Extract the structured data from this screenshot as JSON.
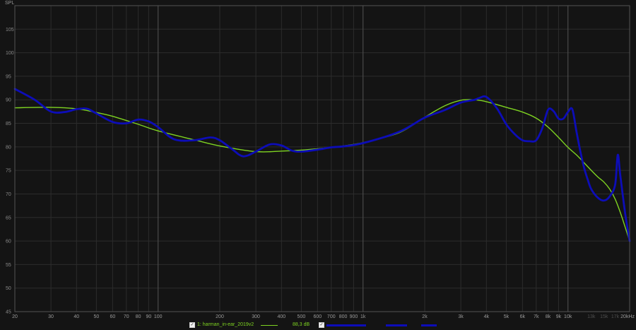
{
  "chart_data": {
    "type": "line",
    "ylabel": "SPL",
    "xscale": "log",
    "xlim": [
      20,
      20000
    ],
    "ylim": [
      45,
      110
    ],
    "grid": true,
    "yticks": [
      45,
      50,
      55,
      60,
      65,
      70,
      75,
      80,
      85,
      90,
      95,
      100,
      105
    ],
    "xticks": [
      {
        "v": 20,
        "t": "20"
      },
      {
        "v": 30,
        "t": "30"
      },
      {
        "v": 40,
        "t": "40"
      },
      {
        "v": 50,
        "t": "50"
      },
      {
        "v": 60,
        "t": "60"
      },
      {
        "v": 70,
        "t": "70"
      },
      {
        "v": 80,
        "t": "80"
      },
      {
        "v": 90,
        "t": "90"
      },
      {
        "v": 100,
        "t": "100"
      },
      {
        "v": 200,
        "t": "200"
      },
      {
        "v": 300,
        "t": "300"
      },
      {
        "v": 400,
        "t": "400"
      },
      {
        "v": 500,
        "t": "500"
      },
      {
        "v": 600,
        "t": "600"
      },
      {
        "v": 700,
        "t": "700"
      },
      {
        "v": 800,
        "t": "800"
      },
      {
        "v": 900,
        "t": "900"
      },
      {
        "v": 1000,
        "t": "1k"
      },
      {
        "v": 2000,
        "t": "2k"
      },
      {
        "v": 3000,
        "t": "3k"
      },
      {
        "v": 4000,
        "t": "4k"
      },
      {
        "v": 5000,
        "t": "5k"
      },
      {
        "v": 6000,
        "t": "6k"
      },
      {
        "v": 7000,
        "t": "7k"
      },
      {
        "v": 8000,
        "t": "8k"
      },
      {
        "v": 9000,
        "t": "9k"
      },
      {
        "v": 10000,
        "t": "10k"
      },
      {
        "v": 13000,
        "t": "13k"
      },
      {
        "v": 15000,
        "t": "15k"
      },
      {
        "v": 17000,
        "t": "17k"
      },
      {
        "v": 20000,
        "t": "20kHz"
      }
    ],
    "series": [
      {
        "name": "1: harman_in-ear_2019v2",
        "color": "#7ed321",
        "width": 1.4,
        "x": [
          20,
          30,
          40,
          50,
          60,
          80,
          100,
          150,
          200,
          300,
          400,
          500,
          600,
          700,
          800,
          1000,
          1500,
          2000,
          2500,
          3000,
          3500,
          4000,
          5000,
          6000,
          7000,
          8000,
          9000,
          10000,
          11000,
          12000,
          13000,
          14000,
          15000,
          16000,
          17000,
          18000,
          19000,
          20000
        ],
        "y": [
          88.3,
          88.4,
          88.1,
          87.3,
          86.5,
          84.8,
          83.4,
          81.5,
          80.2,
          79.0,
          79.1,
          79.3,
          79.6,
          79.9,
          80.2,
          80.9,
          83.0,
          86.3,
          88.7,
          89.9,
          90.0,
          89.6,
          88.4,
          87.4,
          86.1,
          84.2,
          82.0,
          79.9,
          78.3,
          76.6,
          75.0,
          73.6,
          72.5,
          71.0,
          68.9,
          66.1,
          63.0,
          60.0
        ]
      },
      {
        "name": "",
        "color": "#0d0db8",
        "width": 2.8,
        "x": [
          20,
          25,
          30,
          35,
          40,
          45,
          50,
          60,
          70,
          80,
          90,
          100,
          120,
          150,
          180,
          200,
          230,
          260,
          300,
          350,
          400,
          450,
          500,
          600,
          700,
          800,
          1000,
          1500,
          2000,
          2500,
          3000,
          3500,
          3700,
          4000,
          4500,
          5000,
          5500,
          6000,
          6500,
          7000,
          7500,
          8000,
          8500,
          9000,
          9500,
          10000,
          10500,
          11000,
          11500,
          12000,
          12500,
          13000,
          14000,
          15000,
          16000,
          17000,
          17500,
          18000,
          19000,
          20000
        ],
        "y": [
          92.3,
          90.0,
          87.5,
          87.4,
          88.0,
          88.1,
          87.1,
          85.3,
          85.0,
          85.8,
          85.4,
          84.2,
          81.6,
          81.4,
          82.0,
          81.4,
          79.5,
          78.0,
          79.0,
          80.5,
          80.3,
          79.2,
          79.0,
          79.4,
          79.9,
          80.1,
          80.8,
          83.2,
          86.2,
          87.8,
          89.4,
          90.0,
          90.4,
          90.6,
          88.2,
          84.8,
          82.7,
          81.4,
          81.2,
          81.4,
          84.0,
          87.9,
          87.6,
          86.0,
          86.0,
          87.4,
          88.0,
          83.3,
          79.0,
          75.5,
          73.0,
          71.0,
          69.2,
          68.6,
          69.5,
          72.0,
          78.3,
          74.0,
          66.0,
          60.0
        ]
      }
    ]
  },
  "legend": {
    "entry1": {
      "label": "1: harman_in-ear_2019v2",
      "value": "88,3 dB"
    }
  },
  "colors": {
    "background": "#141414",
    "grid_major": "#4a4a4a",
    "grid_minor": "#2c2c2c"
  }
}
